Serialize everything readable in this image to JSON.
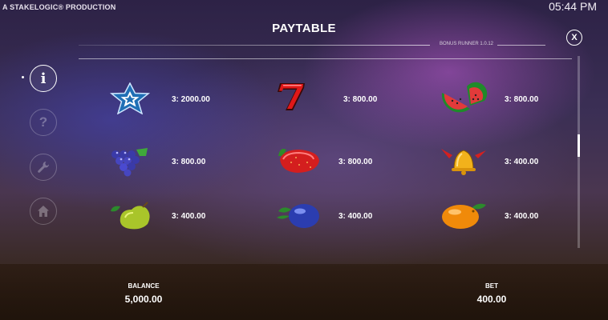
{
  "header": {
    "credit": "A STAKELOGIC® PRODUCTION",
    "clock": "05:44 PM",
    "title": "PAYTABLE",
    "version": "BONUS RUNNER 1.0.12",
    "close_label": "X"
  },
  "side_menu": {
    "info_label": "i",
    "help_label": "?"
  },
  "paytable": [
    {
      "symbol": "blue-star",
      "payout": "3: 2000.00"
    },
    {
      "symbol": "seven",
      "payout": "3: 800.00"
    },
    {
      "symbol": "watermelon",
      "payout": "3: 800.00"
    },
    {
      "symbol": "grapes",
      "payout": "3: 800.00"
    },
    {
      "symbol": "strawberry",
      "payout": "3: 800.00"
    },
    {
      "symbol": "bell",
      "payout": "3: 400.00"
    },
    {
      "symbol": "pear",
      "payout": "3: 400.00"
    },
    {
      "symbol": "plum",
      "payout": "3: 400.00"
    },
    {
      "symbol": "orange",
      "payout": "3: 400.00"
    }
  ],
  "footer": {
    "balance_label": "BALANCE",
    "balance_value": "5,000.00",
    "bet_label": "BET",
    "bet_value": "400.00"
  }
}
